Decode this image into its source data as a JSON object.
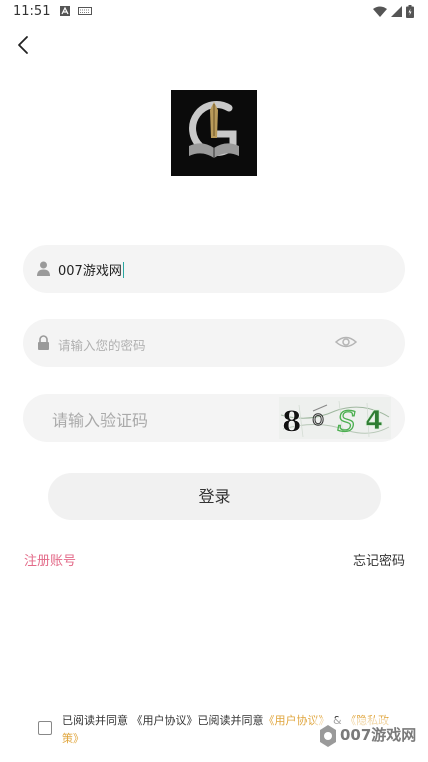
{
  "status_bar": {
    "time": "11:51",
    "icons": [
      "a-notification-icon",
      "keyboard-icon",
      "wifi-icon",
      "signal-icon",
      "battery-icon"
    ]
  },
  "header": {
    "back_icon": "back-chevron-icon"
  },
  "form": {
    "username_value": "007游戏网",
    "password_placeholder": "请输入您的密码",
    "code_placeholder": "请输入验证码",
    "captcha_text": "8 o S 4",
    "login_label": "登录"
  },
  "links": {
    "register": "注册账号",
    "forgot": "忘记密码"
  },
  "agreement": {
    "prefix": "已阅读并同意 《用户协议》已阅读并同意",
    "user_agreement": "《用户协议》",
    "and": "&",
    "privacy_policy": "《隐私政策》"
  },
  "watermark": {
    "text": "007游戏网"
  },
  "colors": {
    "field_bg": "#f4f4f4",
    "register_link": "#e36a88",
    "agreement_link": "#e0a53c",
    "caret": "#2aa6a0"
  }
}
